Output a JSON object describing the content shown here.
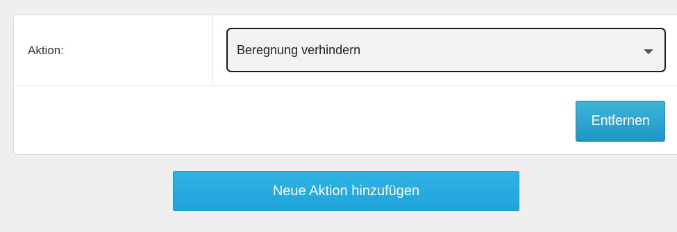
{
  "action_row": {
    "label": "Aktion:",
    "select": {
      "selected_value": "Beregnung verhindern",
      "icon": "chevron-down-icon"
    }
  },
  "buttons": {
    "remove_label": "Entfernen",
    "add_label": "Neue Aktion hinzufügen"
  },
  "colors": {
    "background": "#f0efef",
    "card": "#ffffff",
    "button_blue": "#29abe0",
    "select_border": "#1a1a1a"
  }
}
